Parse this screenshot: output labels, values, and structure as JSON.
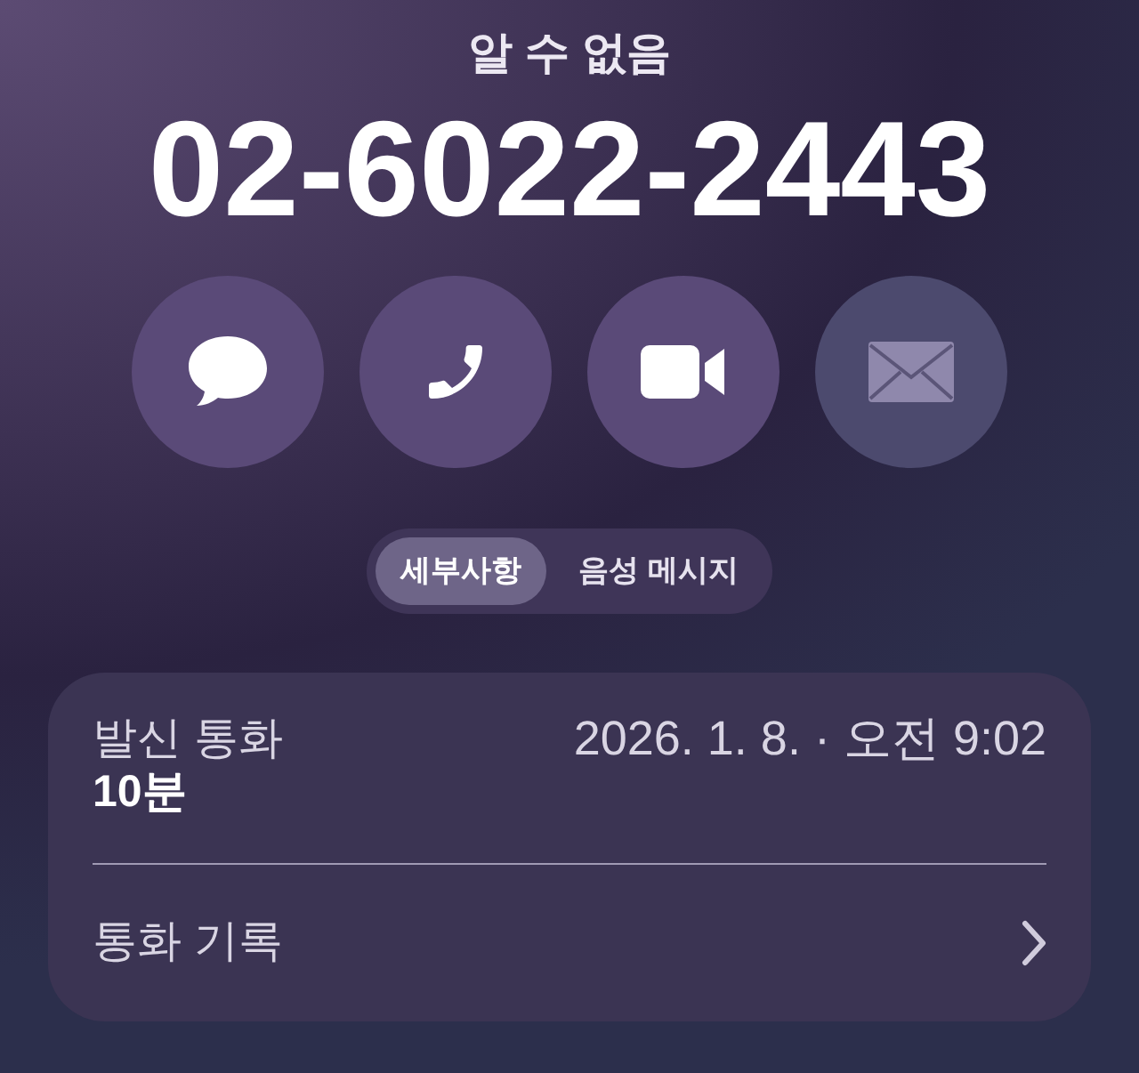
{
  "caller": {
    "name": "알 수 없음",
    "number": "02-6022-2443"
  },
  "actions": [
    {
      "kind": "message",
      "disabled": false
    },
    {
      "kind": "phone",
      "disabled": false
    },
    {
      "kind": "video",
      "disabled": false
    },
    {
      "kind": "mail",
      "disabled": true
    }
  ],
  "tabs": [
    {
      "label": "세부사항",
      "selected": true
    },
    {
      "label": "음성 메시지",
      "selected": false
    }
  ],
  "call": {
    "type": "발신 통화",
    "duration": "10분",
    "time": "2026. 1. 8. · 오전 9:02"
  },
  "history": {
    "label": "통화 기록"
  }
}
